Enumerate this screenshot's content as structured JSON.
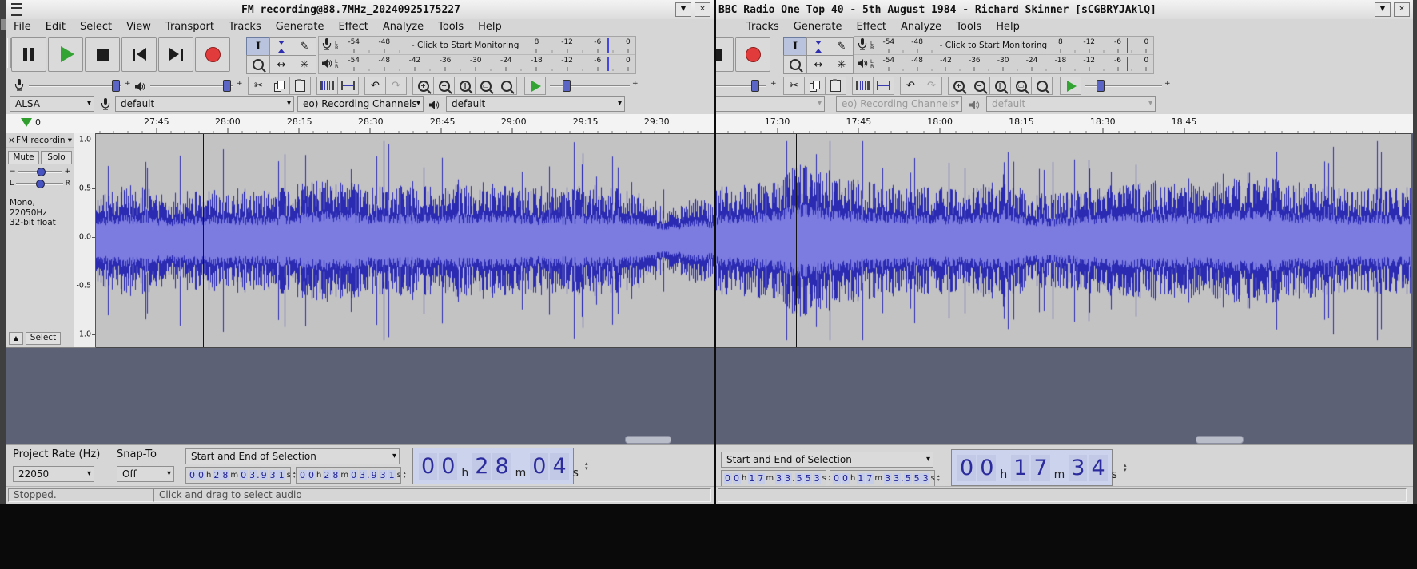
{
  "time_units": [
    "h",
    "m",
    "s"
  ],
  "lr": [
    "L",
    "R"
  ],
  "monitoring_text": "- Click to Start Monitoring",
  "meter_scale": [
    "-54",
    "-48",
    "-42",
    "-36",
    "-30",
    "-24",
    "-18",
    "-12",
    "-6",
    "0"
  ],
  "record_scale_visible": [
    "-54",
    "-48",
    "",
    "",
    "",
    "",
    "8",
    "-12",
    "-6",
    "0"
  ],
  "icons": {
    "caret": "▾",
    "shade": "▼",
    "close": "×",
    "cut": "✂",
    "pencil": "✎",
    "timeshift": "↔",
    "multitool": "✳",
    "undo": "↶",
    "redo": "↷",
    "spin_up": "▴",
    "spin_down": "▾",
    "collapse": "▲",
    "ibeam": "I",
    "plus": "+",
    "minus": "−",
    "zoom_in": "+",
    "zoom_out": "−",
    "zoom_sel": "‖",
    "zoom_fit": "▭"
  },
  "colors": {
    "wave_peak": "#2a2ab2",
    "wave_rms": "#7b7be0",
    "track_bg": "#c3c3c3",
    "play_green": "#33a433",
    "record_red": "#e23b3b",
    "workspace": "#5c6175"
  },
  "windows": {
    "left": {
      "title": "FM recording@88.7MHz_20240925175227",
      "menus": [
        "File",
        "Edit",
        "Select",
        "View",
        "Transport",
        "Tracks",
        "Generate",
        "Effect",
        "Analyze",
        "Tools",
        "Help"
      ],
      "device": {
        "host": "ALSA",
        "record_device": "default",
        "channels": "eo) Recording Channels",
        "play_device": "default"
      },
      "timeline": {
        "zero": "0",
        "labels": [
          "27:45",
          "28:00",
          "28:15",
          "28:30",
          "28:45",
          "29:00",
          "29:15",
          "29:30"
        ],
        "pct": [
          10,
          21.6,
          33.3,
          44.9,
          56.6,
          68.2,
          79.9,
          91.5
        ]
      },
      "track": {
        "name": "FM recordin",
        "mute": "Mute",
        "solo": "Solo",
        "info1": "Mono, 22050Hz",
        "info2": "32-bit float",
        "select": "Select",
        "vruler": {
          "labels": [
            "1.0",
            "0.5",
            "0.0",
            "-0.5",
            "-1.0"
          ],
          "pct": [
            3,
            25.8,
            48.6,
            71.4,
            94.2
          ]
        },
        "wave": {
          "seed": 20240925,
          "cursor_pct": 17.3,
          "envelope": [
            [
              0,
              0.44
            ],
            [
              0.05,
              0.52
            ],
            [
              0.12,
              0.46
            ],
            [
              0.2,
              0.5
            ],
            [
              0.28,
              0.47
            ],
            [
              0.36,
              0.58
            ],
            [
              0.45,
              0.52
            ],
            [
              0.55,
              0.5
            ],
            [
              0.63,
              0.55
            ],
            [
              0.72,
              0.48
            ],
            [
              0.8,
              0.52
            ],
            [
              0.87,
              0.47
            ],
            [
              0.93,
              0.3
            ],
            [
              0.97,
              0.42
            ],
            [
              1,
              0.38
            ]
          ],
          "peak": "#2a2ab2",
          "rms": "#7b7be0",
          "bg": "#c3c3c3"
        }
      },
      "selection": {
        "rate_label": "Project Rate (Hz)",
        "rate": "22050",
        "snap_label": "Snap-To",
        "snap": "Off",
        "mode": "Start and End of Selection",
        "start": "00h28m03.931s",
        "end": "00h28m03.931s",
        "big": {
          "h": "00",
          "m": "28",
          "s": "04"
        }
      },
      "status": {
        "left": "Stopped.",
        "right": "Click and drag to select audio"
      }
    },
    "right": {
      "title": "BBC Radio One Top 40 - 5th August 1984 - Richard Skinner [sCGBRYJAklQ]",
      "menus": [
        "Tracks",
        "Generate",
        "Effect",
        "Analyze",
        "Tools",
        "Help"
      ],
      "device": {
        "channels": "eo) Recording Channels",
        "play_device": "default"
      },
      "timeline": {
        "labels": [
          "17:30",
          "17:45",
          "18:00",
          "18:15",
          "18:30",
          "18:45"
        ],
        "pct": [
          8.8,
          20.5,
          32.2,
          43.9,
          55.6,
          67.3
        ]
      },
      "track": {
        "wave": {
          "seed": 19840805,
          "cursor_pct": 11.5,
          "envelope": [
            [
              0,
              0.5
            ],
            [
              0.07,
              0.55
            ],
            [
              0.12,
              0.72
            ],
            [
              0.17,
              0.6
            ],
            [
              0.25,
              0.52
            ],
            [
              0.33,
              0.5
            ],
            [
              0.4,
              0.55
            ],
            [
              0.47,
              0.44
            ],
            [
              0.55,
              0.5
            ],
            [
              0.63,
              0.56
            ],
            [
              0.7,
              0.5
            ],
            [
              0.76,
              0.64
            ],
            [
              0.83,
              0.55
            ],
            [
              0.9,
              0.5
            ],
            [
              1,
              0.5
            ]
          ],
          "peak": "#2a2ab2",
          "rms": "#7b7be0",
          "bg": "#c3c3c3"
        }
      },
      "selection": {
        "mode": "Start and End of Selection",
        "start": "00h17m33.553s",
        "end": "00h17m33.553s",
        "big": {
          "h": "00",
          "m": "17",
          "s": "34"
        }
      }
    }
  }
}
